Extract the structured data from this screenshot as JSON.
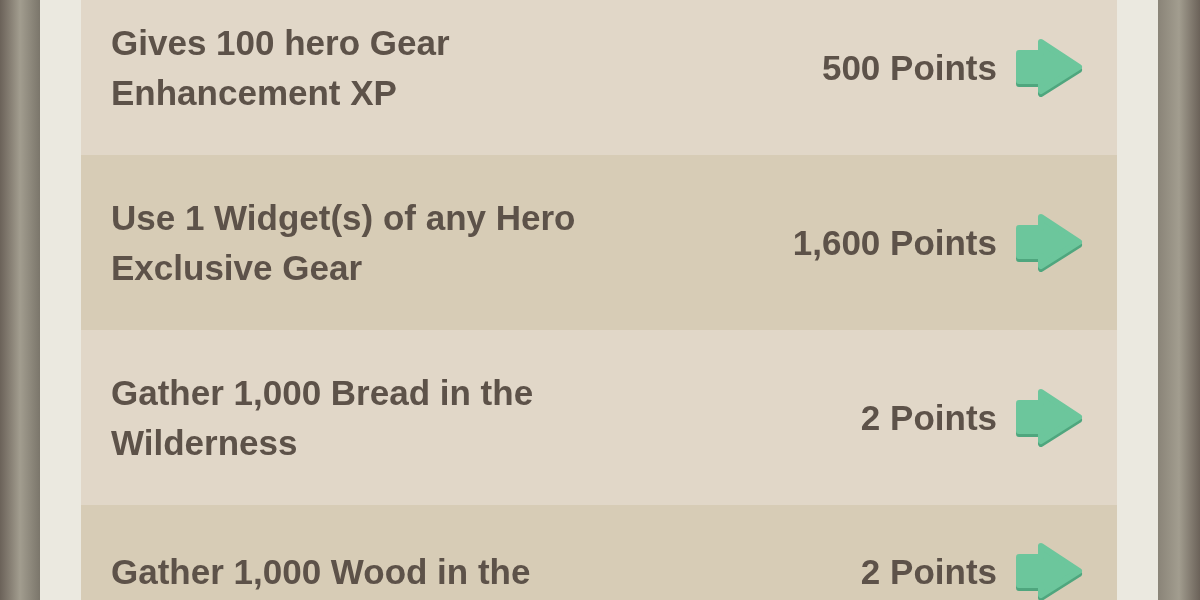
{
  "tasks": [
    {
      "description": "Gives 100 hero Gear Enhancement XP",
      "points": "500 Points"
    },
    {
      "description": "Use 1 Widget(s) of any Hero Exclusive Gear",
      "points": "1,600 Points"
    },
    {
      "description": "Gather 1,000 Bread in the Wilderness",
      "points": "2 Points"
    },
    {
      "description": "Gather 1,000 Wood in the",
      "points": "2 Points"
    }
  ]
}
